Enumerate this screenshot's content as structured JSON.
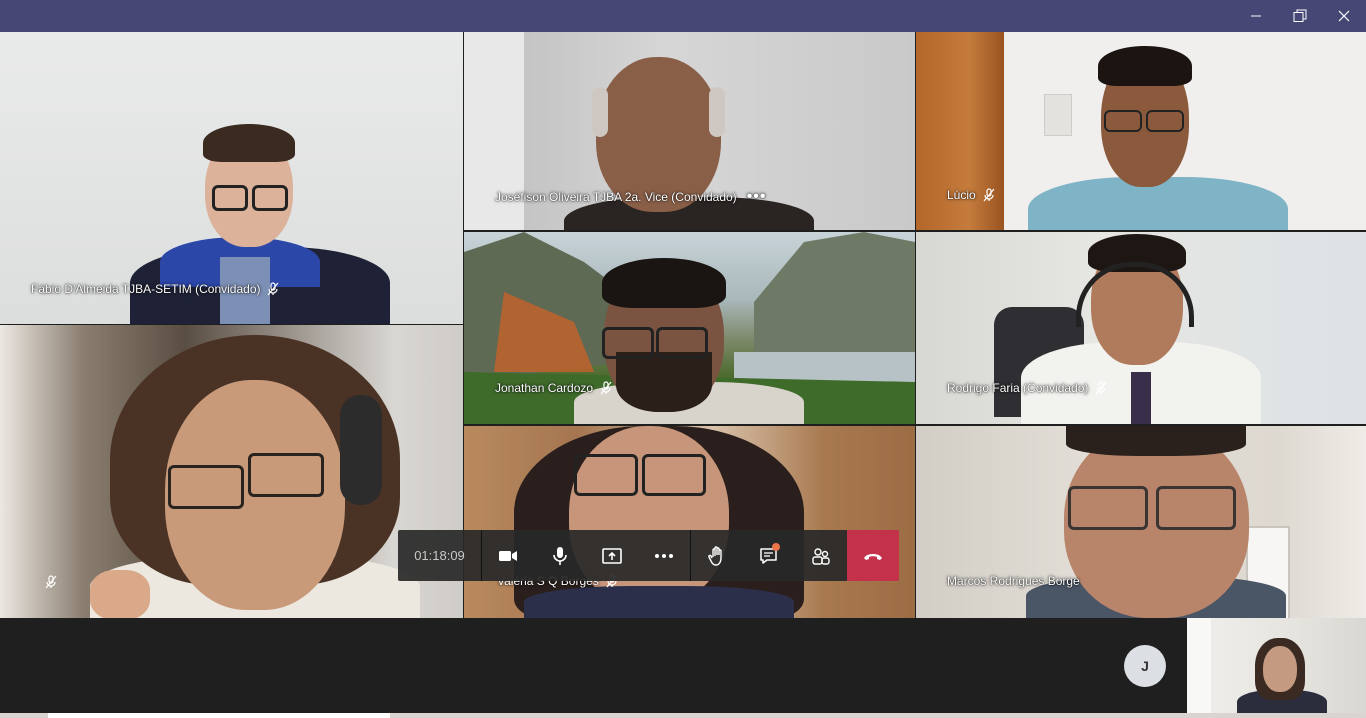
{
  "window": {
    "minimize_icon": "minimize-icon",
    "restore_icon": "restore-icon",
    "close_icon": "close-icon"
  },
  "participants": [
    {
      "name": "Fábio D'Almeida TJBA-SETIM (Convidado)",
      "muted": true
    },
    {
      "name": "Joséfison Oliveira TJBA 2a. Vice (Convidado)",
      "more": "•••"
    },
    {
      "name": "Lúcio",
      "muted": true
    },
    {
      "name": "Jonathan Cardozo",
      "muted": true
    },
    {
      "name": "Rodrigo Faria (Convidado)",
      "muted": true
    },
    {
      "name": "",
      "muted": true
    },
    {
      "name": "Valéria S Q Borges",
      "muted": true
    },
    {
      "name": "Marcos Rodrigues Borge"
    }
  ],
  "controls": {
    "timer": "01:18:09",
    "camera_icon": "video-camera-icon",
    "mic_icon": "microphone-icon",
    "share_icon": "share-screen-icon",
    "more_icon": "more-actions-icon",
    "raise_hand_icon": "raise-hand-icon",
    "chat_icon": "chat-icon",
    "participants_icon": "participants-icon",
    "hangup_icon": "hang-up-icon"
  },
  "bottom": {
    "avatar_initial": "J"
  },
  "colors": {
    "titlebar": "#464775",
    "hangup": "#c4314b",
    "chat_notification": "#e97548"
  }
}
